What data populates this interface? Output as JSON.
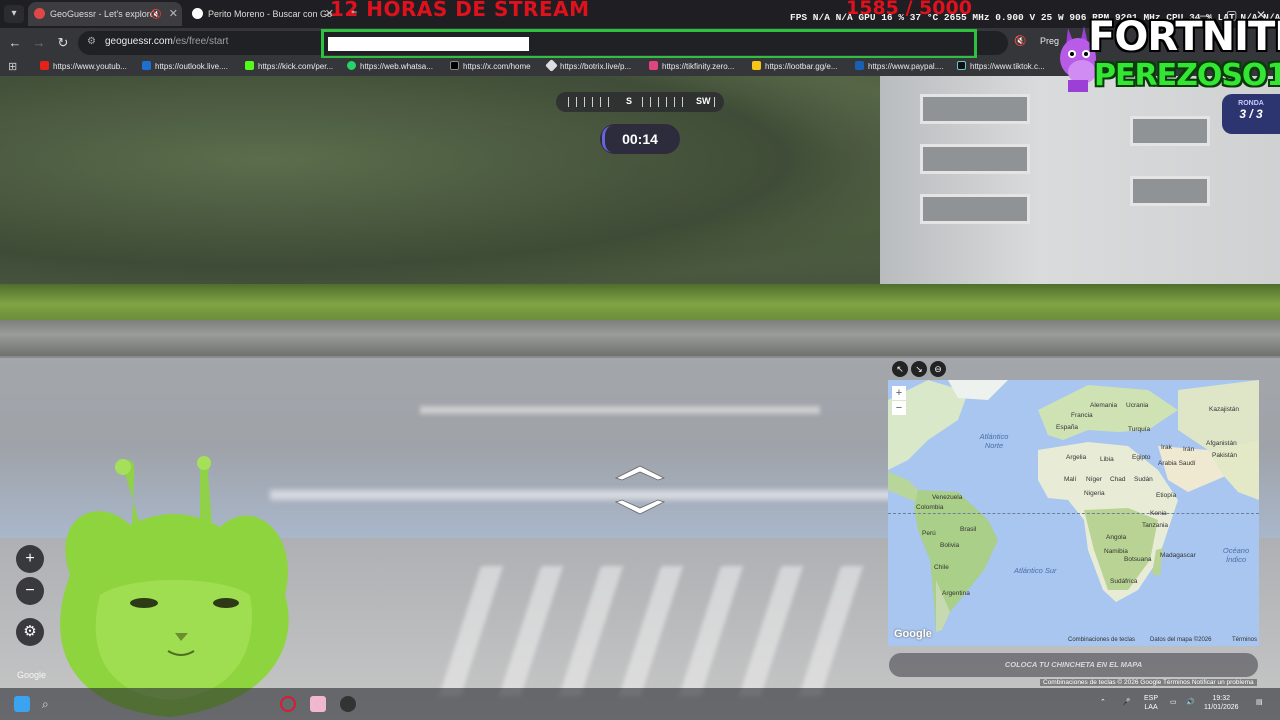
{
  "browser": {
    "tabs": [
      {
        "title": "GeoGuessr - Let's explore t",
        "active": true
      },
      {
        "title": "Perito Moreno - Buscar con Go",
        "active": false
      }
    ],
    "url_host": "geoguessr.com",
    "url_path": "/es/free/start",
    "toolbar_extra": "Preg",
    "bookmarks": [
      "https://www.youtub...",
      "https://outlook.live....",
      "https://kick.com/per...",
      "https://web.whatsa...",
      "https://x.com/home",
      "https://botrix.live/p...",
      "https://tikfinity.zero...",
      "https://lootbar.gg/e...",
      "https://www.paypal....",
      "https://www.tiktok.c..."
    ]
  },
  "stream_overlay": {
    "title": "12 HORAS DE STREAM",
    "score": "1585 / 5000",
    "stats": "FPS  N/A  N/A   GPU  16 %  37 °C  2655 MHz  0.900 V  25 W  906 RPM  9201 MHz     CPU  34 %   LAT  N/A  N/A",
    "fortnite": "FORTNITE",
    "channel": "PEREZOSO1"
  },
  "game": {
    "compass_dirs": [
      "S",
      "SW"
    ],
    "timer": "00:14",
    "round_label": "RONDA",
    "round_value": "3 / 3",
    "streetview_credit": "Google",
    "pin_button": "COLOCA TU CHINCHETA EN EL MAPA",
    "sv_footer": "Combinaciones de teclas   © 2026 Google   Términos   Notificar un problema"
  },
  "map": {
    "labels": {
      "alemania": "Alemania",
      "ucrania": "Ucrania",
      "kazajistan": "Kazajistán",
      "francia": "Francia",
      "espana": "España",
      "turquia": "Turquía",
      "argelia": "Argelia",
      "libia": "Libia",
      "egipto": "Egipto",
      "irak": "Irak",
      "iran": "Irán",
      "afganistan": "Afganistán",
      "pakistan": "Pakistán",
      "arabia": "Arabia Saudí",
      "mali": "Malí",
      "niger": "Níger",
      "chad": "Chad",
      "sudan": "Sudán",
      "nigeria": "Nigeria",
      "etiopia": "Etiopía",
      "kenia": "Kenia",
      "tanzania": "Tanzania",
      "angola": "Angola",
      "namibia": "Namibia",
      "botsuana": "Botsuana",
      "sudafrica": "Sudáfrica",
      "madagascar": "Madagascar",
      "venezuela": "Venezuela",
      "colombia": "Colombia",
      "peru": "Perú",
      "brasil": "Brasil",
      "bolivia": "Bolivia",
      "chile": "Chile",
      "argentina": "Argentina",
      "atlantico_norte": "Atlántico Norte",
      "atlantico_sur": "Atlántico Sur",
      "oceano_indico": "Océano Índico"
    },
    "google": "Google",
    "footer": [
      "Combinaciones de teclas",
      "Datos del mapa ©2026",
      "Términos"
    ]
  },
  "taskbar": {
    "lang": "ESP",
    "lang2": "LAA",
    "time": "19:32",
    "date": "11/01/2026"
  }
}
